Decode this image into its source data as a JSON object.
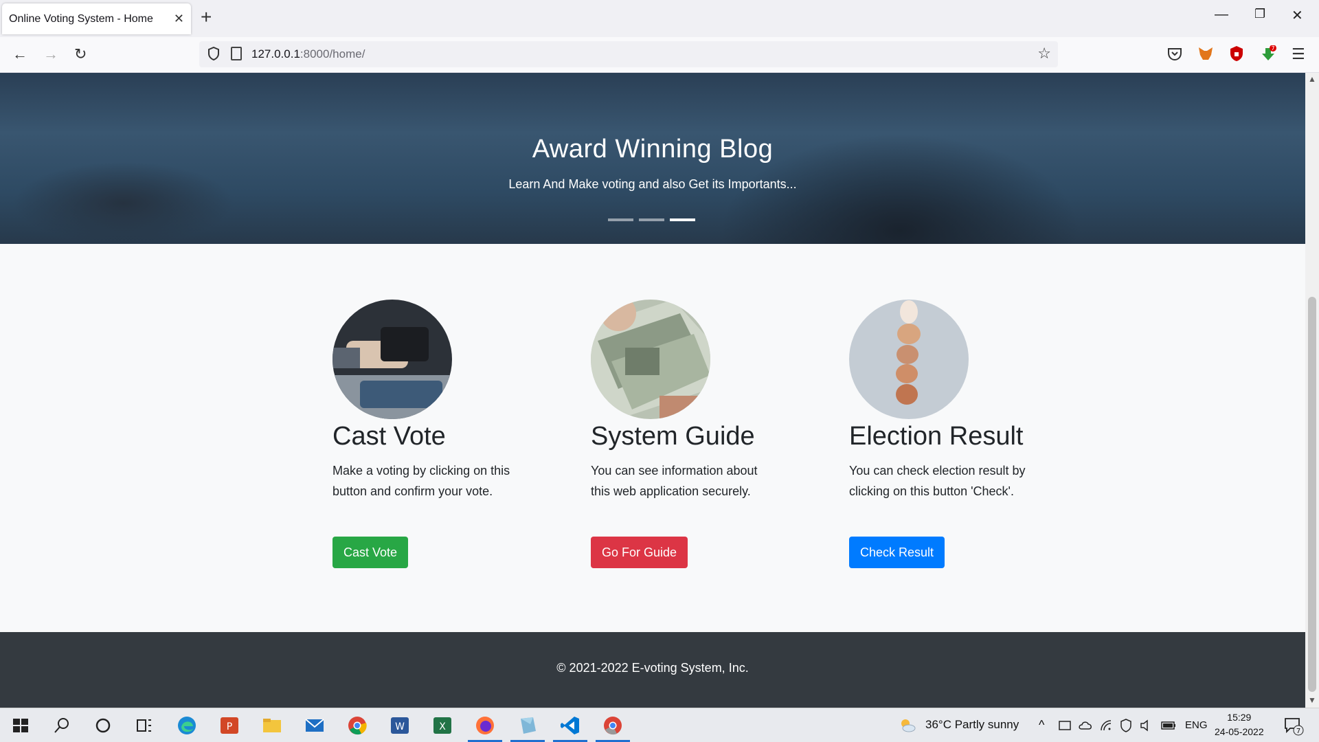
{
  "browser": {
    "tab_title": "Online Voting System - Home",
    "url_host": "127.0.0.1",
    "url_rest": ":8000/home/",
    "ext_badge": "7"
  },
  "hero": {
    "title": "Award Winning Blog",
    "subtitle": "Learn And Make voting and also Get its Importants...",
    "slide_count": 3,
    "active_slide": 3
  },
  "features": [
    {
      "title": "Cast Vote",
      "text": "Make a voting by clicking on this button and confirm your vote.",
      "button": "Cast Vote",
      "button_color": "#28a745"
    },
    {
      "title": "System Guide",
      "text": "You can see information about this web application securely.",
      "button": "Go For Guide",
      "button_color": "#dc3545"
    },
    {
      "title": "Election Result",
      "text": "You can check election result by clicking on this button 'Check'.",
      "button": "Check Result",
      "button_color": "#007bff"
    }
  ],
  "footer": {
    "text": "© 2021-2022 E-voting System, Inc."
  },
  "taskbar": {
    "weather": "36°C  Partly sunny",
    "lang": "ENG",
    "time": "15:29",
    "date": "24-05-2022",
    "notif_count": "7",
    "apps": [
      "start-icon",
      "search-icon",
      "cortana-icon",
      "task-view-icon",
      "edge-icon",
      "powerpoint-icon",
      "file-explorer-icon",
      "mail-icon",
      "chrome-icon",
      "word-icon",
      "excel-icon",
      "firefox-icon",
      "app-icon",
      "vscode-icon",
      "chrome-canary-icon"
    ]
  }
}
